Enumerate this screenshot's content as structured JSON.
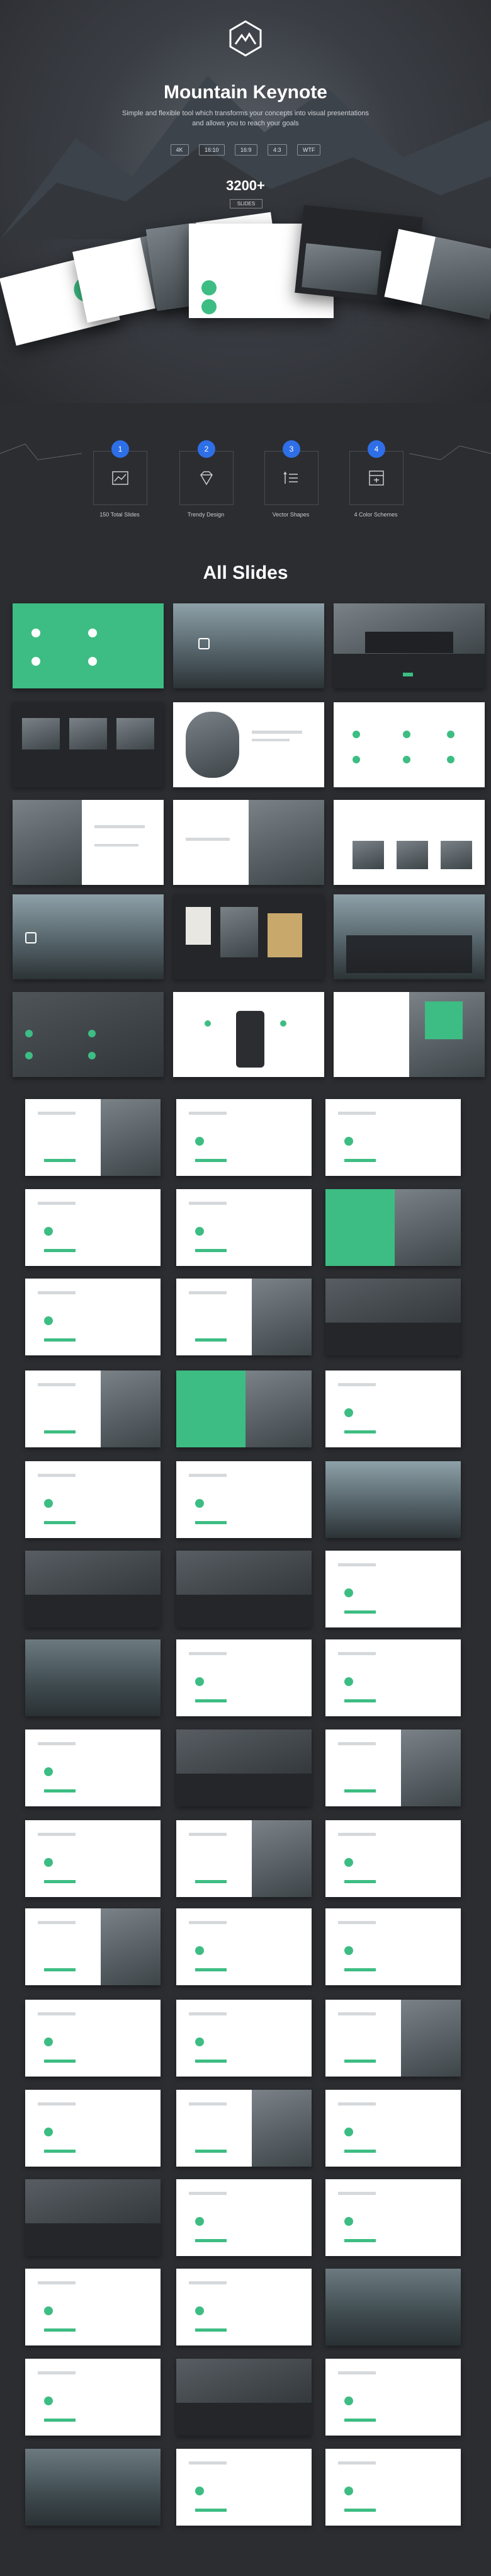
{
  "hero": {
    "title": "Mountain Keynote",
    "subtitle": "Simple and flexible tool which transforms your concepts into visual presentations and allows you to reach your goals",
    "formats": [
      "4K",
      "16:10",
      "16:9",
      "4:3",
      "WTF"
    ],
    "slides_count": "3200+",
    "slides_count_label": "SLIDES"
  },
  "features": [
    {
      "num": "1",
      "label": "150 Total Slides"
    },
    {
      "num": "2",
      "label": "Trendy Design"
    },
    {
      "num": "3",
      "label": "Vector Shapes"
    },
    {
      "num": "4",
      "label": "4 Color Schemes"
    }
  ],
  "all_slides_title": "All Slides",
  "colors": {
    "accent": "#3dbd83",
    "bg": "#2c2d31",
    "badge": "#2e6fe8"
  }
}
